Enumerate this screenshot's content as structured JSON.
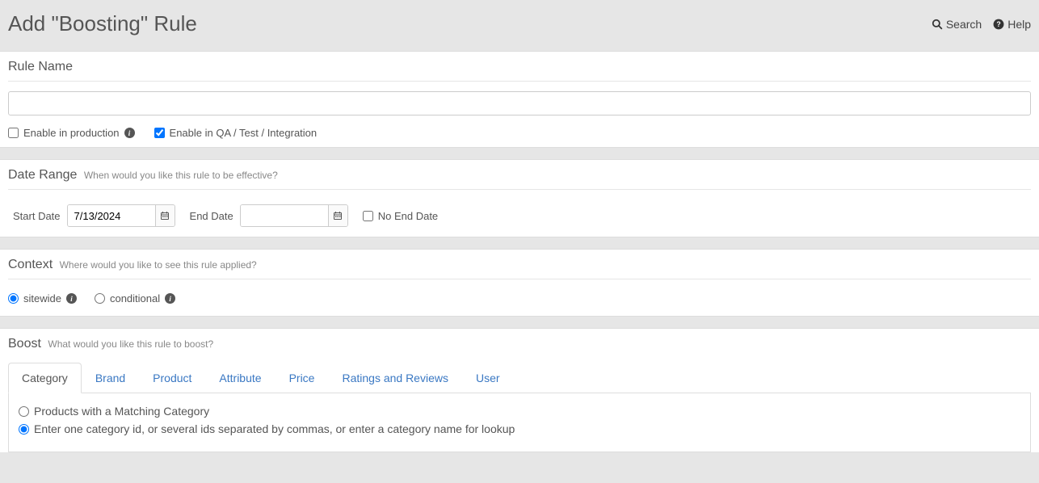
{
  "header": {
    "title": "Add \"Boosting\" Rule",
    "search_label": "Search",
    "help_label": "Help"
  },
  "ruleName": {
    "title": "Rule Name",
    "value": "",
    "enable_production_label": "Enable in production",
    "enable_production_checked": false,
    "enable_qa_label": "Enable in QA / Test / Integration",
    "enable_qa_checked": true
  },
  "dateRange": {
    "title": "Date Range",
    "subtitle": "When would you like this rule to be effective?",
    "start_label": "Start Date",
    "start_value": "7/13/2024",
    "end_label": "End Date",
    "end_value": "",
    "no_end_label": "No End Date",
    "no_end_checked": false
  },
  "context": {
    "title": "Context",
    "subtitle": "Where would you like to see this rule applied?",
    "sitewide_label": "sitewide",
    "conditional_label": "conditional",
    "selected": "sitewide"
  },
  "boost": {
    "title": "Boost",
    "subtitle": "What would you like this rule to boost?",
    "tabs": [
      "Category",
      "Brand",
      "Product",
      "Attribute",
      "Price",
      "Ratings and Reviews",
      "User"
    ],
    "active_tab": "Category",
    "category": {
      "option_matching_label": "Products with a Matching Category",
      "option_ids_label": "Enter one category id, or several ids separated by commas, or enter a category name for lookup",
      "selected": "ids"
    }
  }
}
